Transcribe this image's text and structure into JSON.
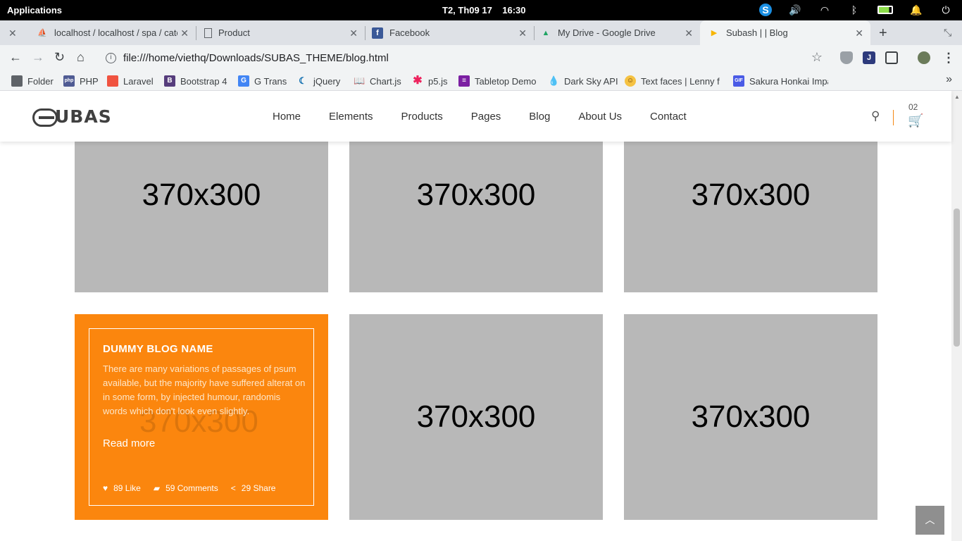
{
  "os": {
    "apps_label": "Applications",
    "clock": "T2, Th09 17    16:30"
  },
  "tabs": [
    {
      "title": "localhost / localhost / spa / cate",
      "active": false
    },
    {
      "title": "Product",
      "active": false
    },
    {
      "title": "Facebook",
      "active": false
    },
    {
      "title": "My Drive - Google Drive",
      "active": false
    },
    {
      "title": "Subash | | Blog",
      "active": true
    }
  ],
  "address": {
    "url": "file:///home/viethq/Downloads/SUBAS_THEME/blog.html"
  },
  "bookmarks": [
    "Folder",
    "PHP",
    "Laravel",
    "Bootstrap 4",
    "G Trans",
    "jQuery",
    "Chart.js",
    "p5.js",
    "Tabletop Demo",
    "Dark Sky API",
    "Text faces | Lenny f",
    "Sakura Honkai Impa"
  ],
  "site": {
    "logo": "UBAS",
    "nav": [
      "Home",
      "Elements",
      "Products",
      "Pages",
      "Blog",
      "About Us",
      "Contact"
    ],
    "cart_count": "02"
  },
  "grid": {
    "placeholder": "370x300",
    "featured": {
      "title": "DUMMY BLOG NAME",
      "description": "There are many variations of passages of psum available, but the majority have suffered alterat on in some form, by injected humour, randomis words which don't look even slightly.",
      "read_more": "Read more",
      "likes": "89 Like",
      "comments": "59 Comments",
      "shares": "29 Share"
    }
  },
  "colors": {
    "accent": "#fb860e",
    "placeholder_bg": "#b8b8b8"
  }
}
